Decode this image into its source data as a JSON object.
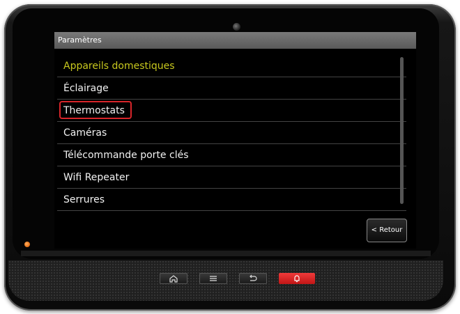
{
  "screen": {
    "title": "Paramètres",
    "menu": [
      {
        "label": "Appareils domestiques",
        "state": "active"
      },
      {
        "label": "Éclairage"
      },
      {
        "label": "Thermostats",
        "highlighted": true
      },
      {
        "label": "Caméras"
      },
      {
        "label": "Télécommande porte clés"
      },
      {
        "label": "Wifi Repeater"
      },
      {
        "label": "Serrures"
      }
    ],
    "back_button": "< Retour"
  },
  "hardware_buttons": [
    {
      "icon": "home-icon"
    },
    {
      "icon": "menu-icon"
    },
    {
      "icon": "back-arrow-icon"
    },
    {
      "icon": "alarm-bell-icon",
      "color": "#e02424"
    }
  ],
  "colors": {
    "active_item": "#c8c81e",
    "highlight_border": "#d8252a",
    "led": "#e46a10"
  }
}
